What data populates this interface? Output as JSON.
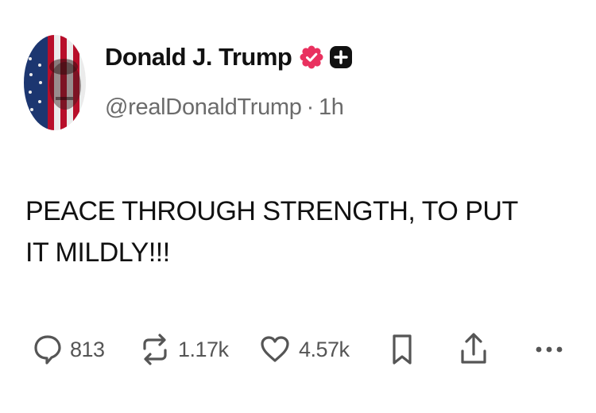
{
  "author": {
    "display_name": "Donald J. Trump",
    "handle": "@realDonaldTrump",
    "separator": "·",
    "time_ago": "1h",
    "avatar_icon": "flag-portrait-avatar",
    "verified_icon": "verified-badge-icon",
    "verified_color": "#e9315f",
    "plus_icon": "plus-badge-icon"
  },
  "post": {
    "text": "PEACE THROUGH STRENGTH, TO PUT IT MILDLY!!!"
  },
  "actions": {
    "reply": {
      "icon": "reply-icon",
      "count": "813"
    },
    "repost": {
      "icon": "repost-icon",
      "count": "1.17k"
    },
    "like": {
      "icon": "heart-icon",
      "count": "4.57k"
    },
    "bookmark": {
      "icon": "bookmark-icon"
    },
    "share": {
      "icon": "share-icon"
    },
    "more": {
      "icon": "more-icon"
    }
  },
  "colors": {
    "text": "#111111",
    "muted": "#6b6b6b",
    "icon": "#555555",
    "flag_red": "#c8102e",
    "flag_blue": "#1f3b7a"
  }
}
